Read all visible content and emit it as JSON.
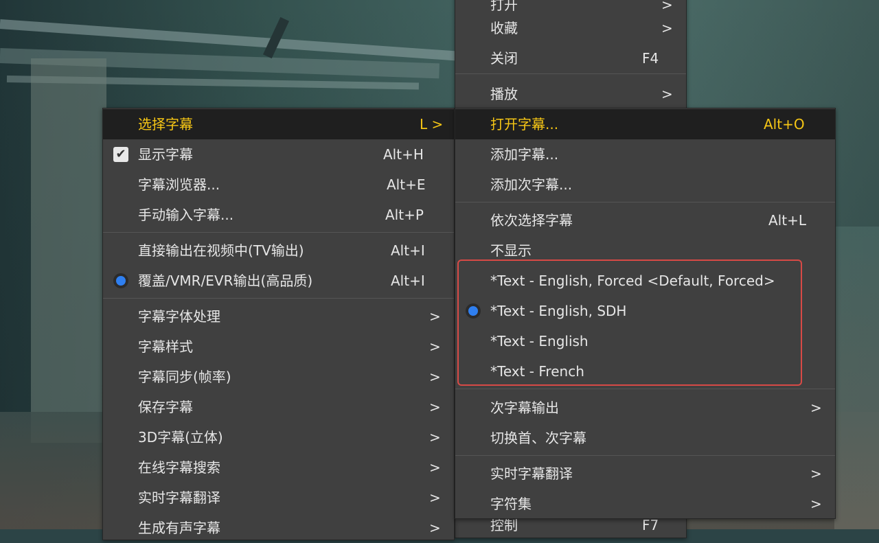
{
  "top_menu": {
    "items": [
      {
        "label": "打开",
        "accel": ">"
      },
      {
        "label": "收藏",
        "accel": ">"
      },
      {
        "label": "关闭",
        "accel": "F4"
      },
      {
        "label": "播放",
        "accel": ">"
      },
      {
        "label": "控制",
        "accel": "F7"
      }
    ]
  },
  "left_menu": {
    "items": [
      {
        "label": "选择字幕",
        "accel": "L >"
      },
      {
        "label": "显示字幕",
        "accel": "Alt+H",
        "checked": true
      },
      {
        "label": "字幕浏览器...",
        "accel": "Alt+E"
      },
      {
        "label": "手动输入字幕...",
        "accel": "Alt+P"
      },
      {
        "label": "直接输出在视频中(TV输出)",
        "accel": "Alt+I"
      },
      {
        "label": "覆盖/VMR/EVR输出(高品质)",
        "accel": "Alt+I",
        "radio": true
      },
      {
        "label": "字幕字体处理",
        "accel": ">"
      },
      {
        "label": "字幕样式",
        "accel": ">"
      },
      {
        "label": "字幕同步(帧率)",
        "accel": ">"
      },
      {
        "label": "保存字幕",
        "accel": ">"
      },
      {
        "label": "3D字幕(立体)",
        "accel": ">"
      },
      {
        "label": "在线字幕搜索",
        "accel": ">"
      },
      {
        "label": "实时字幕翻译",
        "accel": ">"
      },
      {
        "label": "生成有声字幕",
        "accel": ">"
      }
    ]
  },
  "right_menu": {
    "items": [
      {
        "label": "打开字幕...",
        "accel": "Alt+O"
      },
      {
        "label": "添加字幕...",
        "accel": ""
      },
      {
        "label": "添加次字幕...",
        "accel": ""
      },
      {
        "label": "依次选择字幕",
        "accel": "Alt+L"
      },
      {
        "label": "不显示",
        "accel": ""
      },
      {
        "label": "*Text - English, Forced <Default, Forced>",
        "accel": ""
      },
      {
        "label": "*Text - English, SDH",
        "accel": "",
        "radio": true
      },
      {
        "label": "*Text - English",
        "accel": ""
      },
      {
        "label": "*Text - French",
        "accel": ""
      },
      {
        "label": "次字幕输出",
        "accel": ">"
      },
      {
        "label": "切换首、次字幕",
        "accel": ""
      },
      {
        "label": "实时字幕翻译",
        "accel": ">"
      },
      {
        "label": "字符集",
        "accel": ">"
      }
    ]
  },
  "colors": {
    "menu_bg": "#404040",
    "highlight_text": "#f6c615",
    "radio_blue": "#2f7ff0",
    "annotation_red": "#d84a46"
  }
}
